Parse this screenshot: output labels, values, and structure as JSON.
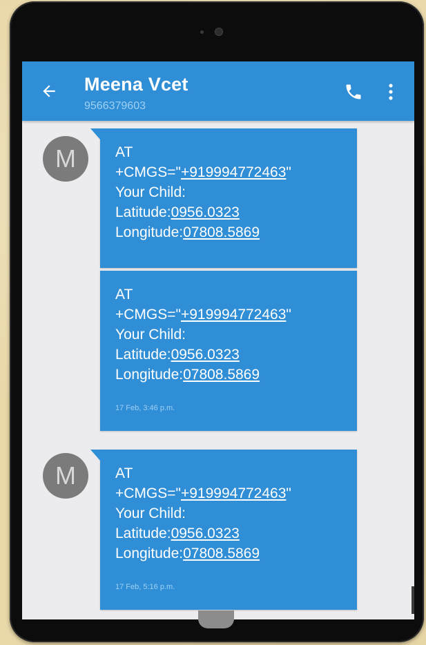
{
  "header": {
    "contact_name": "Meena Vcet",
    "contact_number": "9566379603"
  },
  "icons": {
    "back": "arrow-left",
    "call": "phone",
    "more": "three-dots-vertical"
  },
  "avatar_letter": "M",
  "messages": [
    {
      "line1": "AT",
      "cmd_prefix": "+CMGS=\"",
      "phone": "+919994772463",
      "cmd_suffix": "\"",
      "line3": "Your Child:",
      "lat_label": "Latitude:",
      "lat_value": "0956.0323",
      "lon_label": "Longitude:",
      "lon_value": "07808.5869",
      "time": ""
    },
    {
      "line1": "AT",
      "cmd_prefix": "+CMGS=\"",
      "phone": "+919994772463",
      "cmd_suffix": "\"",
      "line3": "Your Child:",
      "lat_label": "Latitude:",
      "lat_value": "0956.0323",
      "lon_label": "Longitude:",
      "lon_value": "07808.5869",
      "time": "17 Feb, 3:46 p.m."
    },
    {
      "line1": "AT",
      "cmd_prefix": "+CMGS=\"",
      "phone": "+919994772463",
      "cmd_suffix": "\"",
      "line3": "Your Child:",
      "lat_label": "Latitude:",
      "lat_value": "0956.0323",
      "lon_label": "Longitude:",
      "lon_value": "07808.5869",
      "time": "17 Feb, 5:16 p.m."
    }
  ],
  "colors": {
    "app_bar": "#2f8ed6",
    "bubble": "#2f8ed6",
    "screen_bg": "#ececee",
    "avatar": "#7b7b7b"
  }
}
